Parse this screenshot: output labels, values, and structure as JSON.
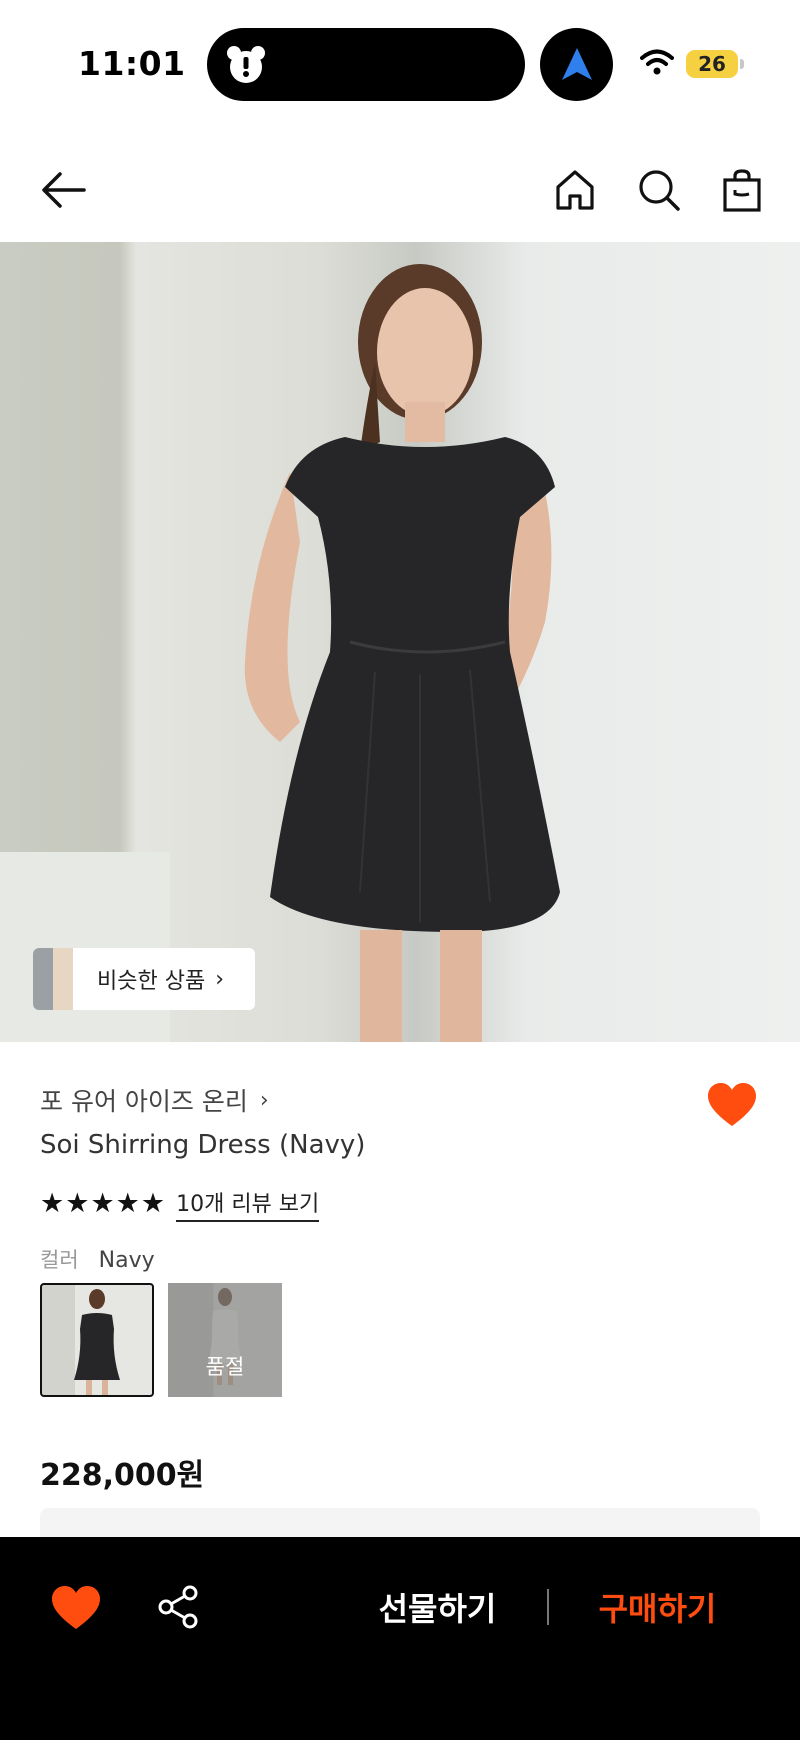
{
  "status_bar": {
    "time": "11:01",
    "battery": "26",
    "icons": [
      "dynamic-island-app-icon",
      "navigation-arrow-icon",
      "wifi-icon",
      "battery-icon"
    ]
  },
  "header": {
    "icons": [
      "back-arrow-icon",
      "home-icon",
      "search-icon",
      "shopping-bag-icon"
    ]
  },
  "hero": {
    "similar_label": "비슷한 상품",
    "similar_chevron": "›"
  },
  "product": {
    "brand": "포 유어 아이즈 온리",
    "brand_chevron": "›",
    "title": "Soi Shirring Dress (Navy)",
    "stars": [
      "★",
      "★",
      "★",
      "★",
      "★"
    ],
    "rating": 5,
    "review_link": "10개 리뷰 보기",
    "color_label": "컬러",
    "color_value": "Navy",
    "swatches": [
      {
        "name": "Navy",
        "selected": true
      },
      {
        "name": "White",
        "status": "품절"
      }
    ],
    "price": "228,000원"
  },
  "bottom_bar": {
    "gift": "선물하기",
    "buy": "구매하기",
    "icons": [
      "heart-icon",
      "share-icon"
    ]
  },
  "colors": {
    "accent": "#FF4C0F",
    "bottom_bar_bg": "#000000",
    "battery": "#F5D142",
    "nav_arrow": "#2F80ED"
  }
}
